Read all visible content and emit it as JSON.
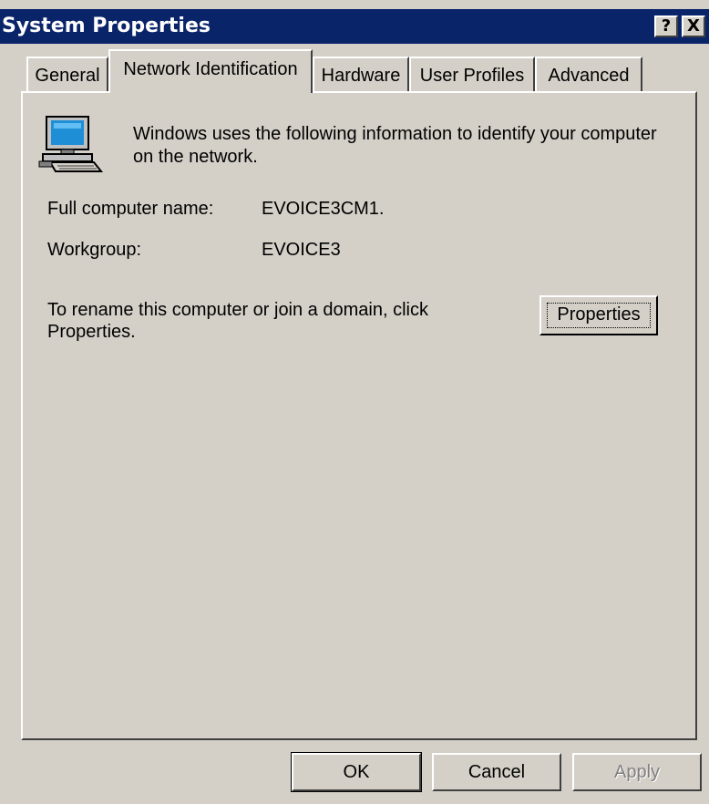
{
  "window": {
    "title": "System Properties",
    "help_label": "?",
    "close_label": "X"
  },
  "tabs": [
    {
      "label": "General",
      "active": false
    },
    {
      "label": "Network Identification",
      "active": true
    },
    {
      "label": "Hardware",
      "active": false
    },
    {
      "label": "User Profiles",
      "active": false
    },
    {
      "label": "Advanced",
      "active": false
    }
  ],
  "panel": {
    "icon": "computer-icon",
    "description_line1": "Windows uses the following information to identify your computer",
    "description_line2": "on the network.",
    "full_name_label": "Full computer name:",
    "full_name_value": "EVOICE3CM1.",
    "workgroup_label": "Workgroup:",
    "workgroup_value": "EVOICE3",
    "rename_line1": "To rename this computer or join a domain, click",
    "rename_line2": "Properties.",
    "properties_button": "Properties"
  },
  "footer": {
    "ok": "OK",
    "cancel": "Cancel",
    "apply": "Apply"
  }
}
